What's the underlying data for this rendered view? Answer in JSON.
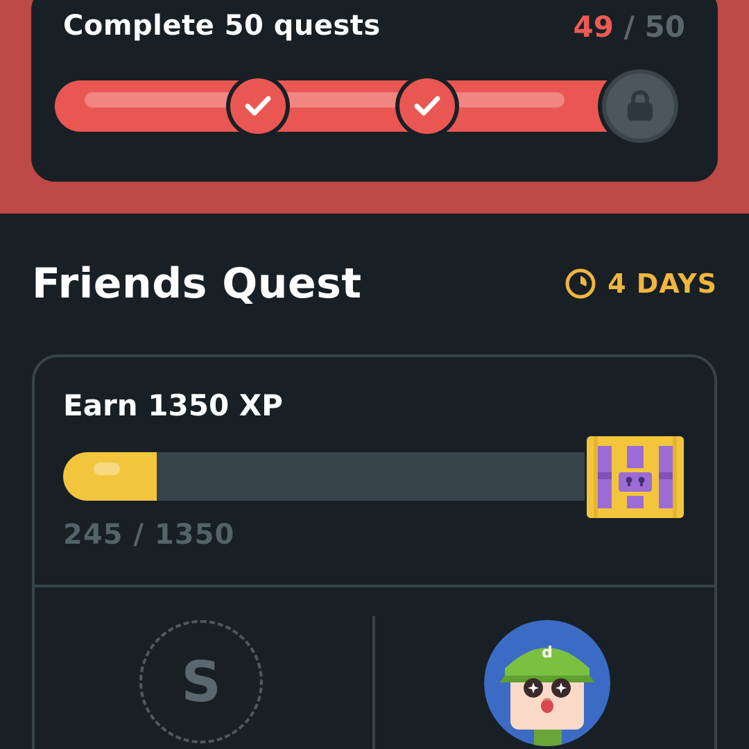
{
  "monthly_quest": {
    "title": "Complete 50 quests",
    "progress_done": "49",
    "progress_sep": " / ",
    "progress_total": "50",
    "progress_fraction": 0.98,
    "milestones": [
      "completed",
      "completed",
      "locked"
    ]
  },
  "friends_quest": {
    "title": "Friends Quest",
    "timer_label": "4 DAYS",
    "card": {
      "title": "Earn 1350 XP",
      "xp_current": 245,
      "xp_total": 1350,
      "xp_text": "245 / 1350"
    },
    "slots": [
      {
        "type": "placeholder",
        "letter": "S"
      },
      {
        "type": "avatar",
        "cap_letter": "d"
      }
    ]
  },
  "icons": {
    "milestone_check": "check-icon",
    "milestone_lock": "lock-icon",
    "timer": "clock-icon",
    "reward": "treasure-chest-icon"
  },
  "colors": {
    "background": "#182025",
    "banner": "#bd4a46",
    "progress_red": "#ea5752",
    "accent_orange": "#f1b640",
    "xp_yellow": "#f3c53c",
    "muted_gray": "#54626a"
  }
}
